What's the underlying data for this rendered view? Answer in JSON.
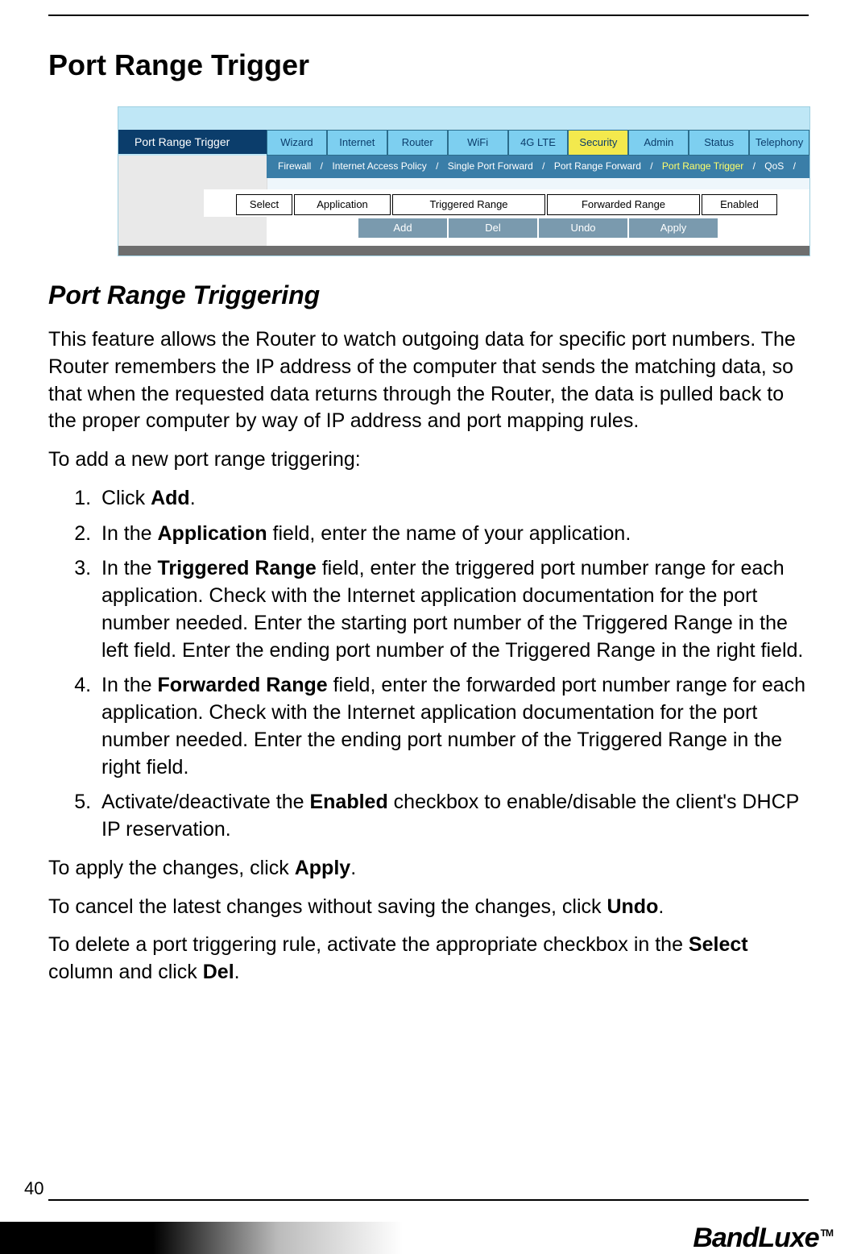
{
  "page_number": "40",
  "brand": "BandLuxe",
  "brand_tm": "TM",
  "h1": "Port Range Trigger",
  "h2": "Port Range Triggering",
  "intro": "This feature allows the Router to watch outgoing data for specific port numbers. The Router remembers the IP address of the computer that sends the matching data, so that when the requested data returns through the Router, the data is pulled back to the proper computer by way of IP address and port mapping rules.",
  "add_line": "To add a new port range triggering:",
  "steps": {
    "s1_pre": "Click ",
    "s1_b": "Add",
    "s1_post": ".",
    "s2_pre": "In the ",
    "s2_b": "Application",
    "s2_post": " field, enter the name of your application.",
    "s3_pre": "In the ",
    "s3_b": "Triggered Range",
    "s3_post": " field, enter the triggered port number range for each application. Check with the Internet application documentation for the port number needed. Enter the starting port number of the Triggered Range in the left field. Enter the ending port number of the Triggered Range in the right field.",
    "s4_pre": "In the ",
    "s4_b": "Forwarded Range",
    "s4_post": " field, enter the forwarded port number range for each application. Check with the Internet application documentation for the port number needed. Enter the ending port number of the Triggered Range in the right field.",
    "s5_pre": "Activate/deactivate the ",
    "s5_b": "Enabled",
    "s5_post": " checkbox to enable/disable the client's DHCP IP reservation."
  },
  "apply_line_pre": "To apply the changes, click ",
  "apply_line_b": "Apply",
  "apply_line_post": ".",
  "undo_line_pre": "To cancel the latest changes without saving the changes, click ",
  "undo_line_b": "Undo",
  "undo_line_post": ".",
  "del_line_pre": "To delete a port triggering rule, activate the appropriate checkbox in the ",
  "del_line_b1": "Select",
  "del_line_mid": " column and click ",
  "del_line_b2": "Del",
  "del_line_post": ".",
  "ui": {
    "left_label": "Port Range Trigger",
    "tabs": [
      "Wizard",
      "Internet",
      "Router",
      "WiFi",
      "4G LTE",
      "Security",
      "Admin",
      "Status",
      "Telephony"
    ],
    "active_tab_index": 5,
    "subtabs": {
      "items": [
        "Firewall",
        "Internet Access Policy",
        "Single Port Forward",
        "Port Range Forward",
        "Port Range Trigger",
        "QoS"
      ],
      "sep": " / ",
      "active_index": 4
    },
    "columns": [
      "Select",
      "Application",
      "Triggered Range",
      "Forwarded Range",
      "Enabled"
    ],
    "buttons": [
      "Add",
      "Del",
      "Undo",
      "Apply"
    ]
  }
}
